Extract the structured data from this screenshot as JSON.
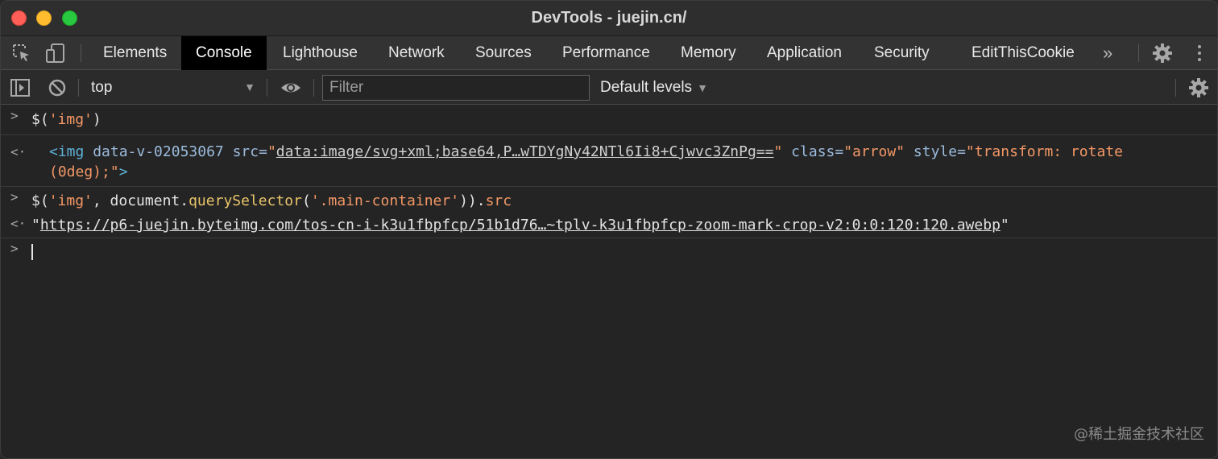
{
  "window": {
    "title": "DevTools - juejin.cn/"
  },
  "tabs": [
    {
      "label": "Elements"
    },
    {
      "label": "Console"
    },
    {
      "label": "Lighthouse"
    },
    {
      "label": "Network"
    },
    {
      "label": "Sources"
    },
    {
      "label": "Performance"
    },
    {
      "label": "Memory"
    },
    {
      "label": "Application"
    },
    {
      "label": "Security"
    },
    {
      "label": "EditThisCookie"
    }
  ],
  "active_tab": "Console",
  "more_tabs_glyph": "»",
  "toolbar": {
    "context": "top",
    "filter_placeholder": "Filter",
    "levels": "Default levels"
  },
  "console": {
    "line1": {
      "prefix": "$(",
      "arg": "'img'",
      "suffix": ")"
    },
    "line2": {
      "open": "<img",
      "attr1_name": " data-v-02053067",
      "attr2_name": " src=",
      "attr2_quote_open": "\"",
      "attr2_value": "data:image/svg+xml;base64,P…wTDYgNy42NTl6Ii8+Cjwvc3ZnPg==",
      "attr2_quote_close": "\"",
      "attr3_name": " class=",
      "attr3_value": "\"arrow\"",
      "attr4_name": " style=",
      "attr4_value": "\"transform: rotate (0deg);\"",
      "close": ">"
    },
    "line3": {
      "prefix": "$(",
      "arg1": "'img'",
      "mid": ", document.",
      "method": "querySelector",
      "paren_open": "(",
      "arg2": "'.main-container'",
      "paren_close": ")).",
      "prop": "src"
    },
    "line4": {
      "quote_open": "\"",
      "url": "https://p6-juejin.byteimg.com/tos-cn-i-k3u1fbpfcp/51b1d76…~tplv-k3u1fbpfcp-zoom-mark-crop-v2:0:0:120:120.awebp",
      "quote_close": "\""
    }
  },
  "watermark": "@稀土掘金技术社区",
  "colors": {
    "active_tab_bg": "#000000",
    "string": "#f29766",
    "method": "#e8c46b",
    "tag": "#5db0d7",
    "prompt": "#4d8df0"
  }
}
